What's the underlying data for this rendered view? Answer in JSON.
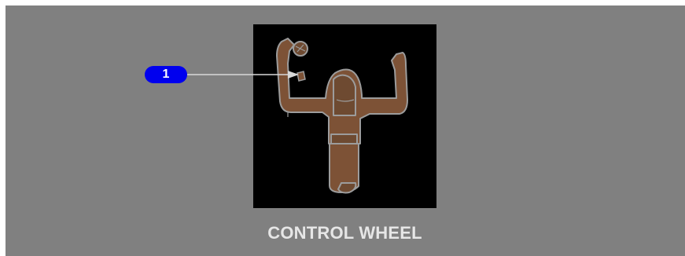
{
  "figure": {
    "caption": "CONTROL WHEEL",
    "callouts": [
      {
        "number": "1",
        "color": "#0000ee"
      }
    ],
    "colors": {
      "background": "#808080",
      "image_background": "#000000",
      "wheel_fill": "#7d5236",
      "wheel_outline": "#9c9c9c",
      "leader_line": "#d8d8d8"
    }
  }
}
